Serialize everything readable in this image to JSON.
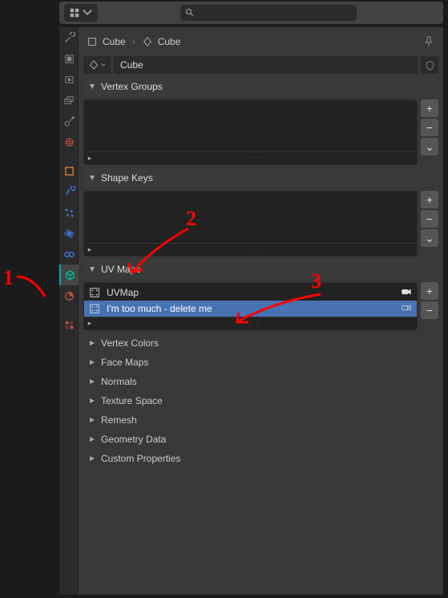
{
  "topbar": {
    "editor_type_icon": "properties-icon",
    "search_placeholder": ""
  },
  "breadcrumb": {
    "item1": {
      "icon": "mesh-icon",
      "label": "Cube"
    },
    "item2": {
      "icon": "object-icon",
      "label": "Cube"
    }
  },
  "name_field": {
    "value": "Cube"
  },
  "tabs": [
    {
      "name": "tool",
      "color": "#888",
      "active": false
    },
    {
      "name": "render",
      "color": "#888",
      "active": false
    },
    {
      "name": "output",
      "color": "#888",
      "active": false
    },
    {
      "name": "view-layer",
      "color": "#888",
      "active": false
    },
    {
      "name": "scene",
      "color": "#888",
      "active": false
    },
    {
      "name": "world",
      "color": "#c05040",
      "active": false
    },
    {
      "name": "object",
      "color": "#d77a2a",
      "active": false,
      "sep": true
    },
    {
      "name": "modifier",
      "color": "#3a7bd5",
      "active": false
    },
    {
      "name": "particles",
      "color": "#3a7bd5",
      "active": false
    },
    {
      "name": "physics",
      "color": "#3a7bd5",
      "active": false
    },
    {
      "name": "constraint",
      "color": "#3a7bd5",
      "active": false
    },
    {
      "name": "mesh-data",
      "color": "#00b894",
      "active": true
    },
    {
      "name": "material",
      "color": "#c05040",
      "active": false
    },
    {
      "name": "texture",
      "color": "#c05040",
      "active": false,
      "sep": true
    }
  ],
  "sections": {
    "vertex_groups": {
      "label": "Vertex Groups",
      "open": true,
      "items": []
    },
    "shape_keys": {
      "label": "Shape Keys",
      "open": true,
      "items": []
    },
    "uv_maps": {
      "label": "UV Maps",
      "open": true,
      "items": [
        {
          "name": "UVMap",
          "selected": false,
          "active_render": true
        },
        {
          "name": "I'm too much - delete me",
          "selected": true,
          "active_render": false
        }
      ]
    },
    "collapsed": [
      {
        "label": "Vertex Colors"
      },
      {
        "label": "Face Maps"
      },
      {
        "label": "Normals"
      },
      {
        "label": "Texture Space"
      },
      {
        "label": "Remesh"
      },
      {
        "label": "Geometry Data"
      },
      {
        "label": "Custom Properties"
      }
    ]
  },
  "buttons": {
    "plus": "+",
    "minus": "−",
    "dropdown": "⌄"
  },
  "annotations": {
    "a1": "1",
    "a2": "2",
    "a3": "3"
  }
}
